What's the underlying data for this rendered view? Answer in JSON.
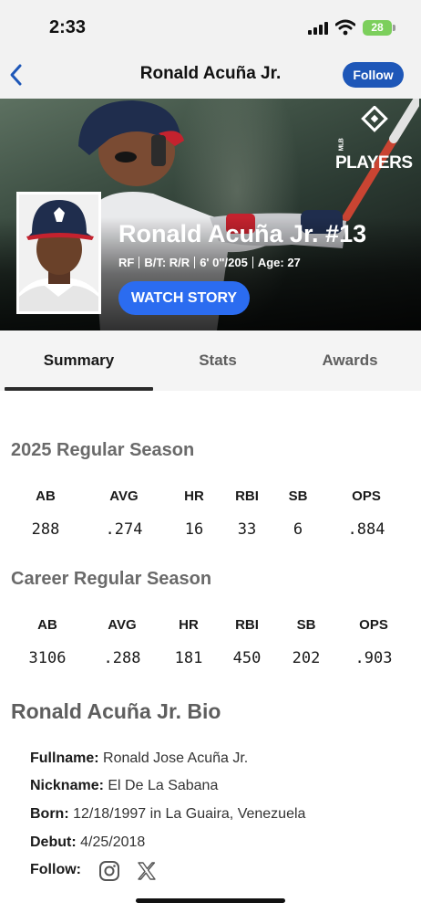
{
  "status_bar": {
    "time": "2:33",
    "battery": "28"
  },
  "nav": {
    "title": "Ronald Acuña Jr.",
    "follow_label": "Follow",
    "back_icon": "chevron-left-icon"
  },
  "hero": {
    "brand_text": "PLAYERS",
    "brand_small": "MLB",
    "player_name": "Ronald Acuña Jr. #13",
    "position": "RF",
    "bats_throws": "B/T: R/R",
    "height_weight": "6' 0\"/205",
    "age": "Age: 27",
    "watch_story_label": "WATCH STORY"
  },
  "tabs": [
    {
      "label": "Summary",
      "active": true
    },
    {
      "label": "Stats",
      "active": false
    },
    {
      "label": "Awards",
      "active": false
    }
  ],
  "season_stats": {
    "title": "2025 Regular Season",
    "headers": [
      "AB",
      "AVG",
      "HR",
      "RBI",
      "SB",
      "OPS"
    ],
    "values": [
      "288",
      ".274",
      "16",
      "33",
      "6",
      ".884"
    ]
  },
  "career_stats": {
    "title": "Career Regular Season",
    "headers": [
      "AB",
      "AVG",
      "HR",
      "RBI",
      "SB",
      "OPS"
    ],
    "values": [
      "3106",
      ".288",
      "181",
      "450",
      "202",
      ".903"
    ]
  },
  "bio": {
    "title": "Ronald Acuña Jr. Bio",
    "fullname_label": "Fullname:",
    "fullname": "Ronald Jose Acuña Jr.",
    "nickname_label": "Nickname:",
    "nickname": "El De La Sabana",
    "born_label": "Born:",
    "born": "12/18/1997 in La Guaira, Venezuela",
    "debut_label": "Debut:",
    "debut": "4/25/2018",
    "follow_label": "Follow:",
    "social_icons": [
      "instagram-icon",
      "x-icon"
    ]
  },
  "colors": {
    "accent": "#1e57b8",
    "watch_button": "#2b6cf0",
    "battery": "#7ccf5c"
  }
}
